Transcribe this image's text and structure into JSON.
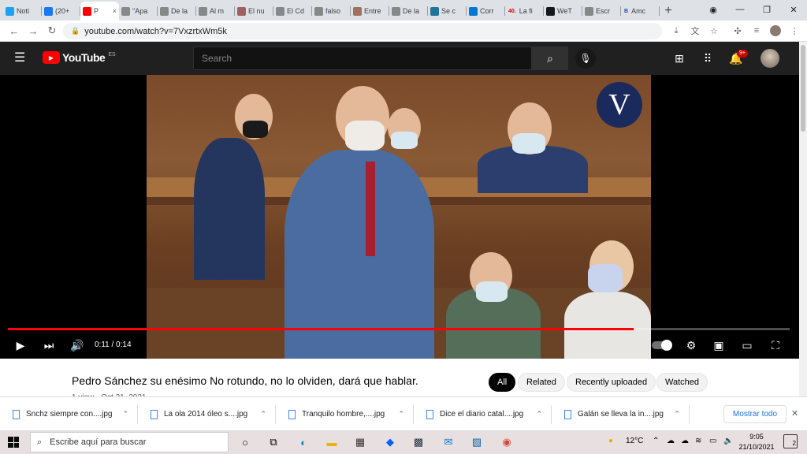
{
  "browser": {
    "tabs": [
      {
        "label": "Noti",
        "icon": "twitter-icon",
        "color": "#1da1f2"
      },
      {
        "label": "(20+",
        "icon": "facebook-icon",
        "color": "#1877f2"
      },
      {
        "label": "P",
        "icon": "youtube-icon",
        "color": "#ff0000",
        "active": true,
        "close": "×"
      },
      {
        "label": "\"Apa",
        "icon": "mail-icon",
        "color": "#888888"
      },
      {
        "label": "De la",
        "icon": "mail-icon",
        "color": "#888888"
      },
      {
        "label": "Al m",
        "icon": "mail-icon",
        "color": "#888888"
      },
      {
        "label": "El nu",
        "icon": "image-icon",
        "color": "#a06060"
      },
      {
        "label": "El Cd",
        "icon": "mail-icon",
        "color": "#888888"
      },
      {
        "label": "falso",
        "icon": "mail-icon",
        "color": "#888888"
      },
      {
        "label": "Entre",
        "icon": "image-icon",
        "color": "#a07060"
      },
      {
        "label": "De la",
        "icon": "mail-icon",
        "color": "#888888"
      },
      {
        "label": "Se c",
        "icon": "wordpress-icon",
        "color": "#21759b"
      },
      {
        "label": "Corr",
        "icon": "outlook-icon",
        "color": "#0078d4"
      },
      {
        "label": "La fi",
        "icon": "news-icon",
        "color": "#d40000",
        "badge": "40."
      },
      {
        "label": "WeT",
        "icon": "wetransfer-icon",
        "color": "#17181a"
      },
      {
        "label": "Escr",
        "icon": "mail-icon",
        "color": "#888888"
      },
      {
        "label": "Amc",
        "icon": "bing-icon",
        "color": "#1a4fa0",
        "badge": "B"
      }
    ],
    "new_tab": "+",
    "url": "youtube.com/watch?v=7VxzrtxWm5k"
  },
  "youtube": {
    "logo_text": "YouTube",
    "country": "ES",
    "search_placeholder": "Search",
    "notif_count": "9+",
    "channel_logo": "V",
    "time": "0:11 / 0:14",
    "progress": 0.8,
    "title": "Pedro Sánchez su enésimo No rotundo, no lo olviden, dará que hablar.",
    "meta": "1 view · Oct 21, 2021",
    "chips": [
      "All",
      "Related",
      "Recently uploaded",
      "Watched"
    ]
  },
  "downloads": {
    "items": [
      "Snchz siempre con....jpg",
      "La ola 2014 óleo s....jpg",
      "Tranquilo hombre,....jpg",
      "Dice el diario catal....jpg",
      "Galán se lleva la in....jpg"
    ],
    "show_all": "Mostrar todo"
  },
  "taskbar": {
    "search_placeholder": "Escribe aquí para buscar",
    "temperature": "12°C",
    "time": "9:05",
    "date": "21/10/2021",
    "chat_count": "2"
  }
}
